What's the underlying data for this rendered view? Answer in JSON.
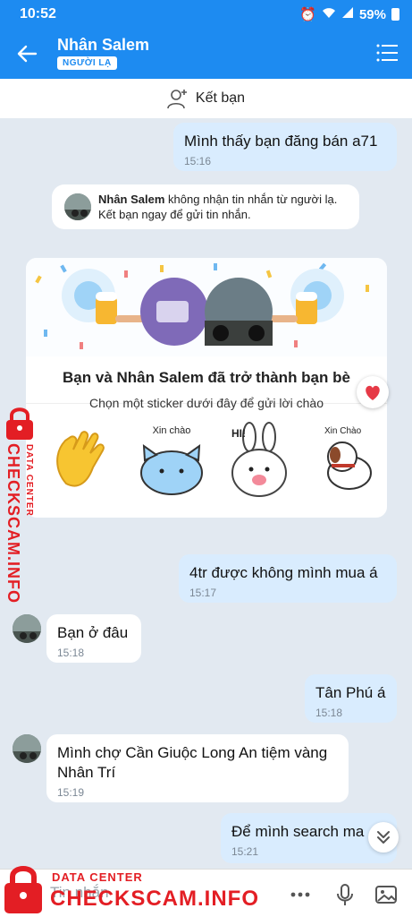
{
  "status": {
    "time": "10:52",
    "battery": "59%"
  },
  "header": {
    "name": "Nhân Salem",
    "badge": "NGƯỜI LẠ"
  },
  "add_friend": {
    "label": "Kết bạn"
  },
  "messages": [
    {
      "text": "Mình thấy bạn đăng bán a71",
      "time": "15:16"
    },
    {
      "text": "4tr được không mình mua á",
      "time": "15:17"
    },
    {
      "text": "Bạn ở đâu",
      "time": "15:18"
    },
    {
      "text": "Tân Phú á",
      "time": "15:18"
    },
    {
      "text": "Mình chợ Cần Giuộc Long An tiệm vàng Nhân Trí",
      "time": "15:19"
    },
    {
      "text": "Để mình search ma",
      "time": "15:21"
    }
  ],
  "notice": {
    "name": "Nhân Salem",
    "text": " không nhận tin nhắn từ người lạ. Kết bạn ngay để gửi tin nhắn."
  },
  "friend_card": {
    "title": "Bạn và Nhân Salem đã trở thành bạn bè",
    "subtitle": "Chọn một sticker dưới đây để gửi lời chào",
    "sticker_texts": [
      "Xin chào",
      "HI!",
      "Xin Chào"
    ]
  },
  "composer": {
    "placeholder": "Tin nhắn"
  },
  "watermark": {
    "small": "DATA CENTER",
    "big": "CHECKSCAM.INFO"
  },
  "colors": {
    "accent": "#1d8bf1",
    "my_bubble": "#d9ecfe",
    "background": "#e2e9f1",
    "watermark": "#e31e24"
  }
}
